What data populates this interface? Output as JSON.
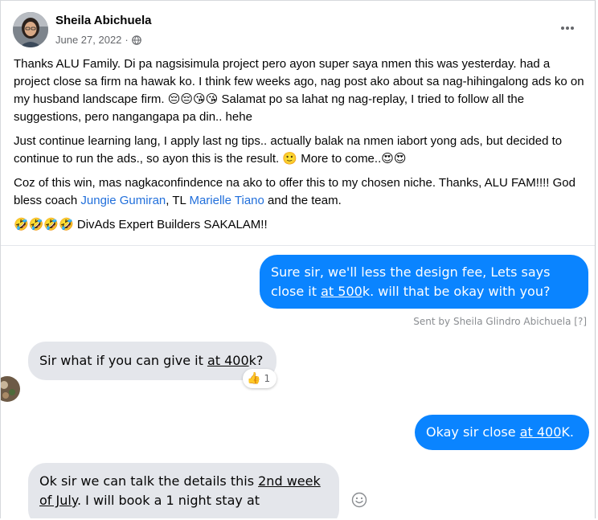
{
  "post": {
    "author": "Sheila Abichuela",
    "date": "June 27, 2022",
    "audience_icon": "globe-icon",
    "more_icon": "more-options-icon",
    "paragraphs": {
      "p1": "Thanks ALU Family. Di pa nagsisimula project pero ayon super saya nmen this was yesterday. had a project close sa firm na hawak ko. I think few weeks ago, nag post ako about sa nag-hihingalong ads ko on my husband landscape firm. 😔😔😘😘 Salamat po sa lahat ng nag-replay, I tried to follow all the suggestions, pero nangangapa pa din.. hehe",
      "p2": "Just continue learning lang, I apply last ng tips.. actually balak na nmen iabort yong ads, but decided to continue to run the ads., so ayon this is the result. 🙂 More to come..😍😍",
      "p3_before": "Coz of this win, mas nagkaconfindence na ako to offer this to my chosen niche. Thanks, ALU FAM!!!! God bless coach ",
      "p3_link1": "Jungie Gumiran",
      "p3_mid": ", TL ",
      "p3_link2": "Marielle Tiano",
      "p3_after": " and the team.",
      "p4": "🤣🤣🤣🤣 DivAds Expert Builders SAKALAM!!"
    }
  },
  "chat": {
    "msg1": {
      "line1": "Sure sir, we'll less the design fee, Lets says",
      "line2_pre": "close it ",
      "line2_u": "at 500",
      "line2_post": "k. will that be okay with you?"
    },
    "sent_by": "Sent by Sheila Glindro Abichuela [?]",
    "msg2": {
      "pre": "Sir what if you can give it ",
      "u": "at 400",
      "post": "k?"
    },
    "reaction": {
      "icon": "thumbs-up-icon",
      "emoji": "👍",
      "count": "1"
    },
    "msg3": {
      "pre": "Okay sir close ",
      "u": "at 400",
      "post": "K."
    },
    "msg4": {
      "pre": "Ok sir we can talk the details this ",
      "u1": "2nd week",
      "u2": "of July",
      "post": ". I will book a 1 night stay at"
    },
    "emoji_button_icon": "smile-icon"
  }
}
